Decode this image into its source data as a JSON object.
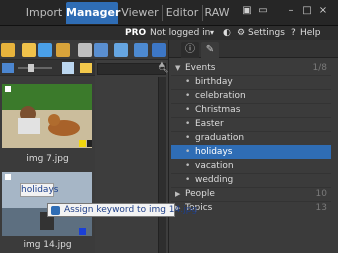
{
  "nav": {
    "tabs": [
      {
        "label": "Import"
      },
      {
        "label": "Manager"
      },
      {
        "label": "Viewer"
      },
      {
        "label": "Editor"
      },
      {
        "label": "RAW"
      }
    ]
  },
  "status": {
    "badge": "PRO",
    "login": "Not logged in",
    "settings": "Settings",
    "help": "Help"
  },
  "browser": {
    "items": [
      {
        "filename": "img 7.jpg"
      },
      {
        "filename": "img 14.jpg"
      }
    ],
    "drag_label": "holidays"
  },
  "keywords": {
    "groups": [
      {
        "label": "Events",
        "count": "1/8",
        "expanded": true,
        "children": [
          {
            "label": "birthday"
          },
          {
            "label": "celebration"
          },
          {
            "label": "Christmas"
          },
          {
            "label": "Easter"
          },
          {
            "label": "graduation"
          },
          {
            "label": "holidays",
            "selected": true
          },
          {
            "label": "vacation"
          },
          {
            "label": "wedding"
          }
        ]
      },
      {
        "label": "People",
        "count": "10",
        "expanded": false
      },
      {
        "label": "Topics",
        "count": "13",
        "expanded": false
      }
    ]
  },
  "tooltip": {
    "text": "Assign keyword to img 14.jpg"
  },
  "colors": {
    "accent": "#2f6db5",
    "panel": "#3b3b3b"
  }
}
